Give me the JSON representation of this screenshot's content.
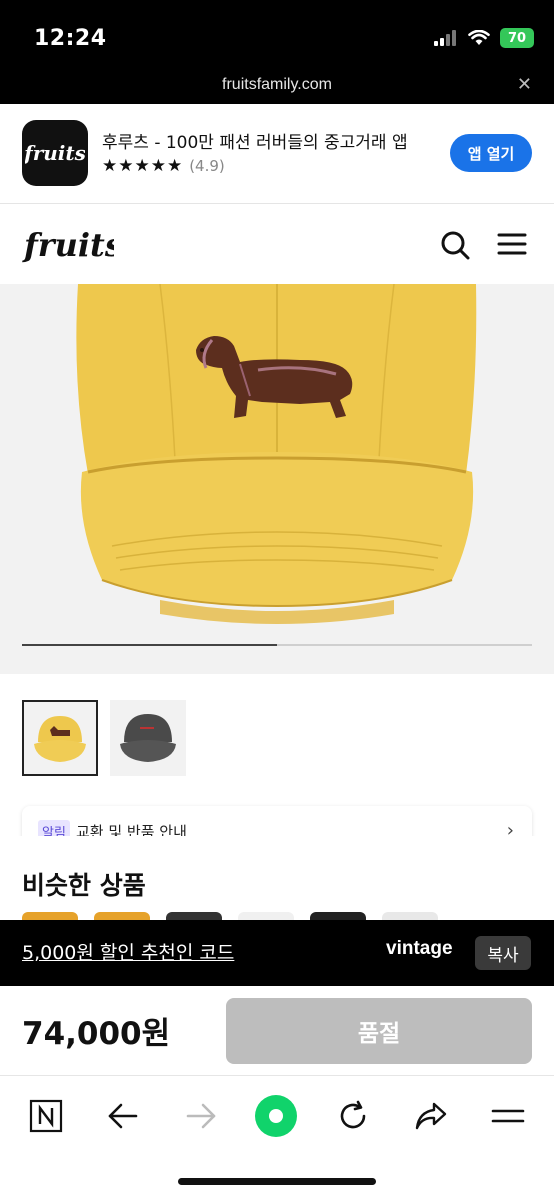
{
  "status_bar": {
    "time": "12:24",
    "battery": "70",
    "url": "fruitsfamily.com",
    "close_icon": "close-icon"
  },
  "app_banner": {
    "title": "후루츠 - 100만 패션 러버들의 중고거래 앱",
    "stars": "★★★★★",
    "rating": "(4.9)",
    "open_label": "앱 열기",
    "icon_text": "fruits"
  },
  "site_header": {
    "logo_text": "fruits",
    "search_icon": "search-icon",
    "menu_icon": "hamburger-menu-icon"
  },
  "gallery": {
    "progress": 0.5,
    "thumbnails": [
      {
        "name": "yellow-cap-thumbnail",
        "color": "#eec84d",
        "selected": true
      },
      {
        "name": "gray-cap-thumbnail",
        "color": "#4a4a4a",
        "selected": false
      }
    ]
  },
  "notice": {
    "badge": "알림",
    "text": "교환 및 반품 안내"
  },
  "similar": {
    "title": "비슷한 상품"
  },
  "referral": {
    "text": "5,000원 할인 추천인 코드",
    "code": "vintage",
    "copy_label": "복사"
  },
  "purchase": {
    "price": "74,000원",
    "button_label": "품절"
  },
  "toolbar": {
    "items": [
      "n-icon",
      "back-arrow-icon",
      "forward-arrow-icon",
      "home-dot-icon",
      "refresh-icon",
      "share-icon",
      "menu-lines-icon"
    ]
  },
  "colors": {
    "accent_blue": "#1a73e8",
    "cap_yellow": "#eec84d",
    "dog_brown": "#5c2e1e",
    "sold_out_gray": "#bdbdbd",
    "green_home": "#10d36b"
  }
}
